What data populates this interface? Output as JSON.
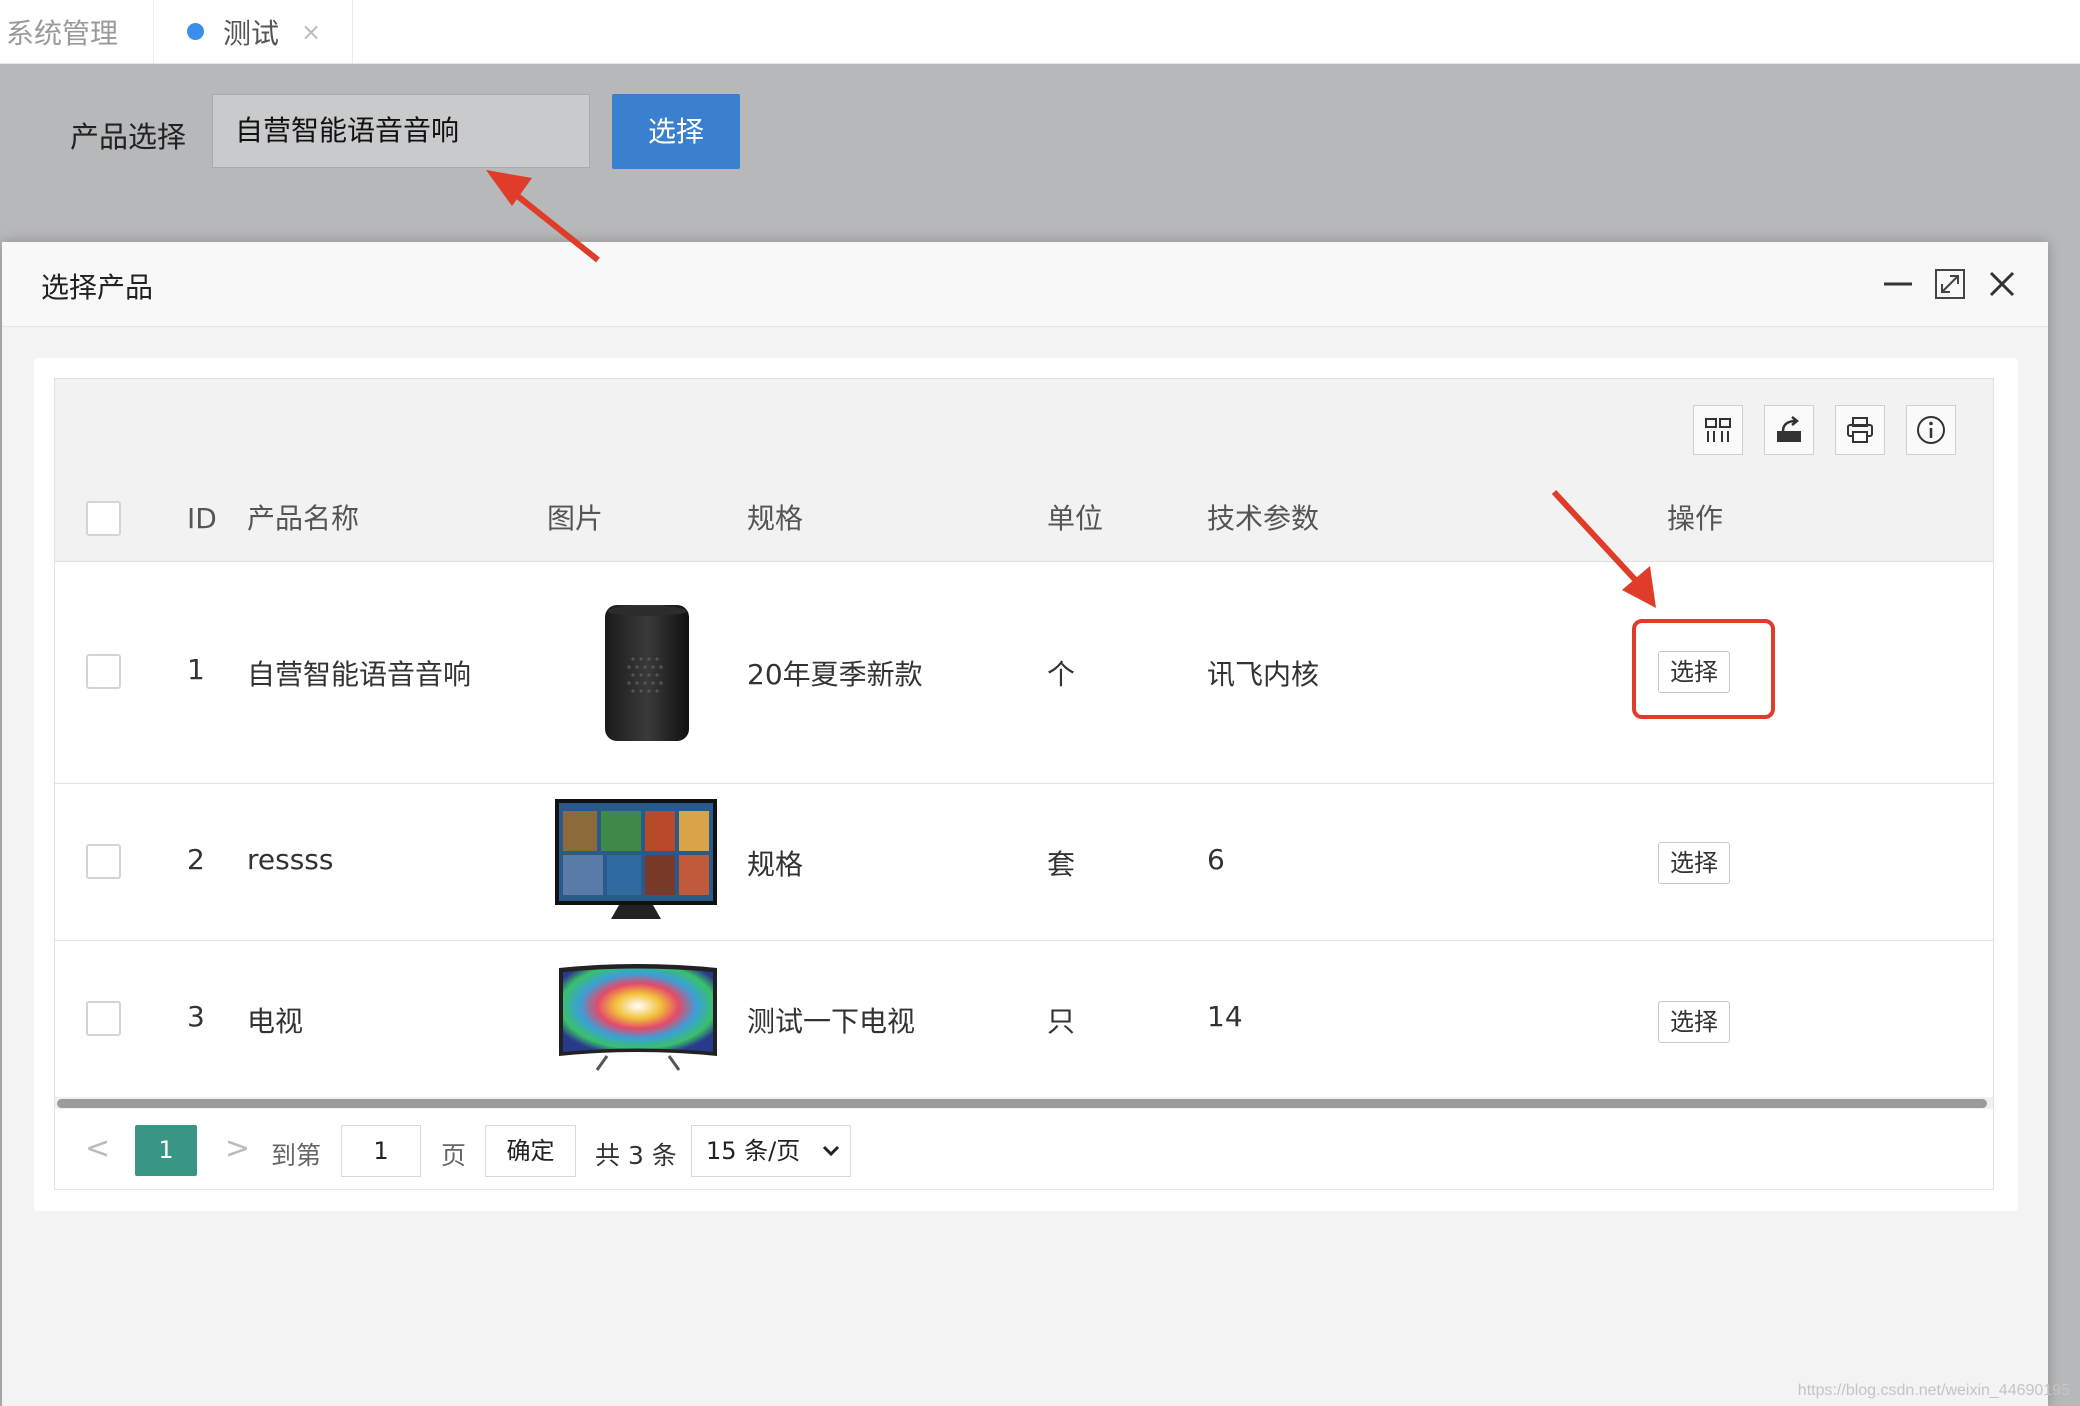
{
  "tabs": [
    {
      "label": "系统管理"
    },
    {
      "label": "测试",
      "close": "×"
    }
  ],
  "form": {
    "label": "产品选择",
    "input_value": "自营智能语音音响",
    "button_label": "选择"
  },
  "modal": {
    "title": "选择产品",
    "header_icons": [
      "minimize-icon",
      "maximize-icon",
      "close-icon"
    ],
    "toolbar_icons": [
      "columns-icon",
      "export-icon",
      "print-icon",
      "info-icon"
    ],
    "columns": [
      "ID",
      "产品名称",
      "图片",
      "规格",
      "单位",
      "技术参数",
      "操作"
    ],
    "rows": [
      {
        "id": "1",
        "name": "自营智能语音音响",
        "image": "smart-speaker-image",
        "spec": "20年夏季新款",
        "unit": "个",
        "params": "讯飞内核",
        "action": "选择"
      },
      {
        "id": "2",
        "name": "ressss",
        "image": "flat-tv-image",
        "spec": "规格",
        "unit": "套",
        "params": "6",
        "action": "选择"
      },
      {
        "id": "3",
        "name": "电视",
        "image": "curved-tv-image",
        "spec": "测试一下电视",
        "unit": "只",
        "params": "14",
        "action": "选择"
      }
    ],
    "pagination": {
      "prev": "<",
      "current_page": "1",
      "next": ">",
      "goto_label": "到第",
      "goto_value": "1",
      "page_suffix": "页",
      "confirm": "确定",
      "total": "共 3 条",
      "page_size": "15 条/页"
    }
  },
  "watermark": "https://blog.csdn.net/weixin_44690195",
  "colors": {
    "accent_blue": "#3b7fcf",
    "page_active": "#3a9684",
    "annotation_red": "#e03c2a"
  }
}
